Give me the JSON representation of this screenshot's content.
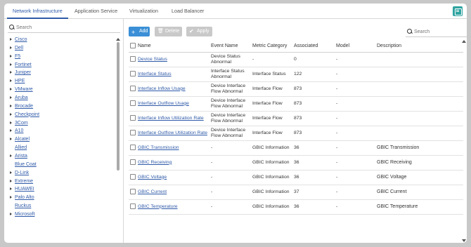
{
  "tabs": [
    {
      "label": "Network Infrastructure",
      "active": true
    },
    {
      "label": "Application Service",
      "active": false
    },
    {
      "label": "Virtualization",
      "active": false
    },
    {
      "label": "Load Balancer",
      "active": false
    }
  ],
  "sidebar": {
    "search_placeholder": "Search",
    "items": [
      {
        "label": "Cisco",
        "has_children": true
      },
      {
        "label": "Dell",
        "has_children": true
      },
      {
        "label": "F5",
        "has_children": true
      },
      {
        "label": "Fortinet",
        "has_children": true
      },
      {
        "label": "Juniper",
        "has_children": true
      },
      {
        "label": "HPE",
        "has_children": true
      },
      {
        "label": "VMware",
        "has_children": true
      },
      {
        "label": "Aruba",
        "has_children": true
      },
      {
        "label": "Brocade",
        "has_children": true
      },
      {
        "label": "Checkpoint",
        "has_children": true
      },
      {
        "label": "3Com",
        "has_children": true
      },
      {
        "label": "A10",
        "has_children": true
      },
      {
        "label": "Alcatel",
        "has_children": true
      },
      {
        "label": "Allied",
        "has_children": false
      },
      {
        "label": "Arista",
        "has_children": true
      },
      {
        "label": "Blue Coat",
        "has_children": false
      },
      {
        "label": "D-Link",
        "has_children": true
      },
      {
        "label": "Extreme",
        "has_children": true
      },
      {
        "label": "HUAWEI",
        "has_children": true
      },
      {
        "label": "Palo Alto",
        "has_children": true
      },
      {
        "label": "Ruckus",
        "has_children": false
      },
      {
        "label": "Microsoft",
        "has_children": true
      }
    ]
  },
  "toolbar": {
    "add_label": "Add",
    "delete_label": "Delete",
    "apply_label": "Apply",
    "search_placeholder": "Search"
  },
  "table": {
    "headers": [
      "Name",
      "Event Name",
      "Metric Category",
      "Associated",
      "Model",
      "Description"
    ],
    "rows": [
      {
        "name": "Device Status",
        "event": "Device Status\nAbnormal",
        "category": "-",
        "associated": "0",
        "model": "-",
        "description": ""
      },
      {
        "name": "Interface Status",
        "event": "Interface Status\nAbnormal",
        "category": "Interface Status",
        "associated": "122",
        "model": "-",
        "description": ""
      },
      {
        "name": "Interface Inflow Usage",
        "event": "Device Interface\nFlow Abnormal",
        "category": "Interface Flow",
        "associated": "873",
        "model": "-",
        "description": ""
      },
      {
        "name": "Interface Outflow Usage",
        "event": "Device Interface\nFlow Abnormal",
        "category": "Interface Flow",
        "associated": "873",
        "model": "-",
        "description": ""
      },
      {
        "name": "Interface Inflow Utilization Rate",
        "event": "Device Interface\nFlow Abnormal",
        "category": "Interface Flow",
        "associated": "873",
        "model": "-",
        "description": ""
      },
      {
        "name": "Interface Outflow Utilization Rate",
        "event": "Device Interface\nFlow Abnormal",
        "category": "Interface Flow",
        "associated": "873",
        "model": "-",
        "description": ""
      },
      {
        "name": "GBIC Transmission",
        "event": "-",
        "category": "GBIC Information",
        "associated": "36",
        "model": "-",
        "description": "GBIC Transmission"
      },
      {
        "name": "GBIC Receiving",
        "event": "-",
        "category": "GBIC Information",
        "associated": "36",
        "model": "-",
        "description": "GBIC Receiving"
      },
      {
        "name": "GBIC Voltage",
        "event": "-",
        "category": "GBIC Information",
        "associated": "36",
        "model": "-",
        "description": "GBIC Voltage"
      },
      {
        "name": "GBIC Current",
        "event": "-",
        "category": "GBIC Information",
        "associated": "37",
        "model": "-",
        "description": "GBIC Current"
      },
      {
        "name": "GBIC Temperature",
        "event": "-",
        "category": "GBIC Information",
        "associated": "36",
        "model": "-",
        "description": "GBIC Temperature"
      }
    ]
  }
}
